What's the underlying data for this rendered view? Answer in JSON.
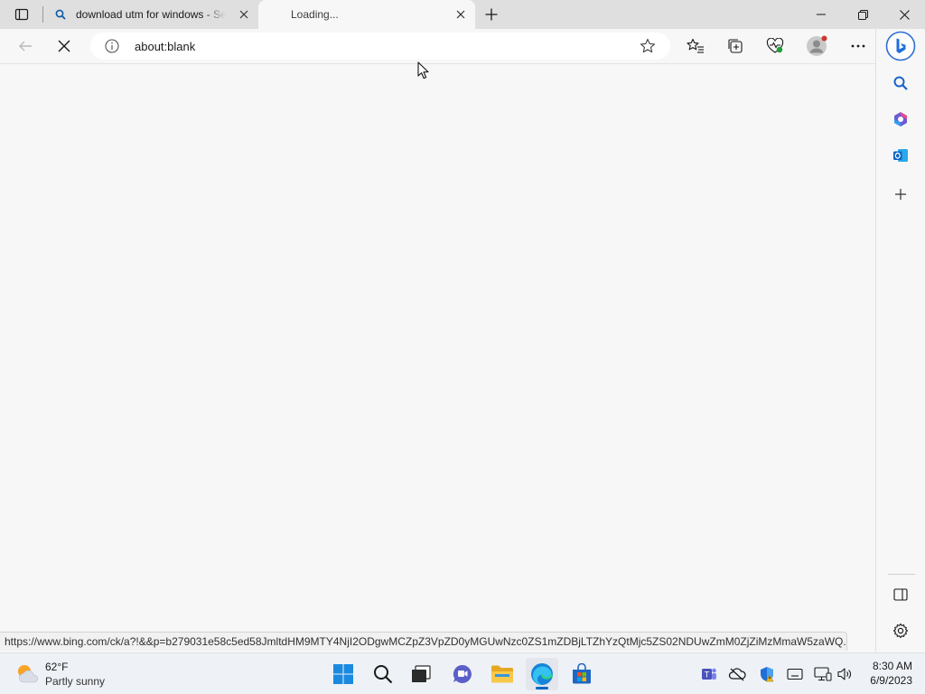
{
  "browser": {
    "tabs": [
      {
        "title": "download utm for windows - Search",
        "icon": "search-icon",
        "active": false
      },
      {
        "title": "Loading...",
        "icon": "loading",
        "active": true
      }
    ],
    "address": {
      "url": "about:blank"
    },
    "status_url": "https://www.bing.com/ck/a?!&&p=b279031e58c5ed58JmltdHM9MTY4NjI2ODgwMCZpZ3VpZD0yMGUwNzc0ZS1mZDBjLTZhYzQtMjc5ZS02NDUwZmM0ZjZiMzMmaW5zaWQ...",
    "accent_color": "#0c59a4"
  },
  "taskbar": {
    "weather": {
      "temp": "62°F",
      "condition": "Partly sunny"
    },
    "apps": [
      "start",
      "search",
      "task-view",
      "chat",
      "file-explorer",
      "edge",
      "store"
    ],
    "clock": {
      "time": "8:30 AM",
      "date": "6/9/2023"
    }
  }
}
